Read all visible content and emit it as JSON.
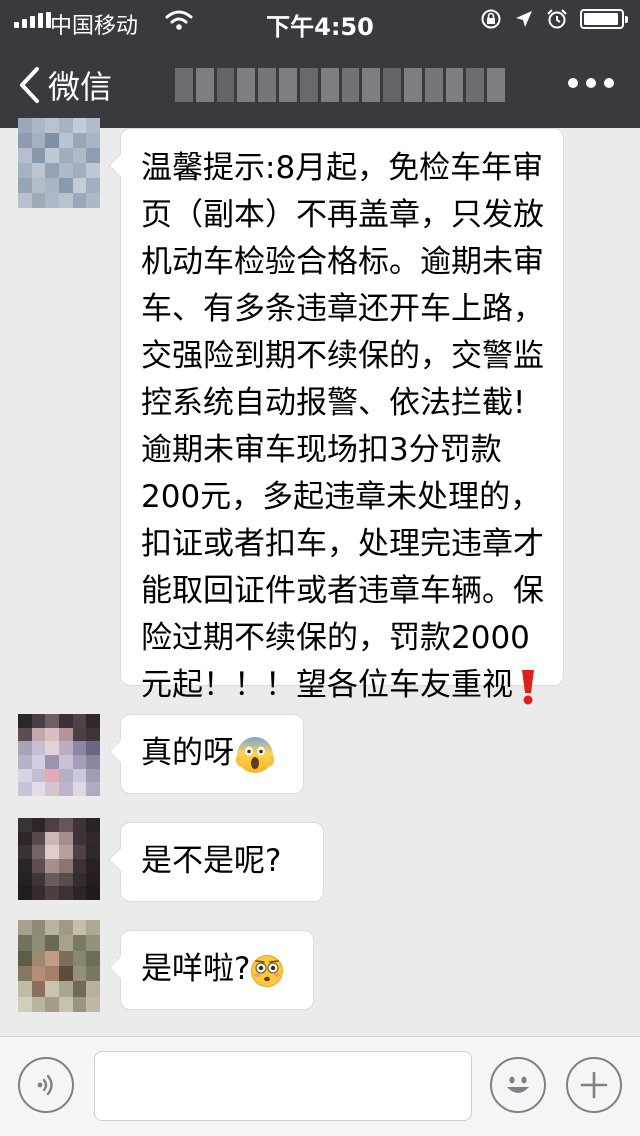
{
  "status_bar": {
    "carrier": "中国移动",
    "time": "下午4:50",
    "battery_level": 0.95
  },
  "nav": {
    "back_label": "微信",
    "more_icon": "more-dots-icon"
  },
  "messages": [
    {
      "sender": "other",
      "text": "温馨提示:8月起，免检车年审页（副本）不再盖章，只发放机动车检验合格标。逾期未审车、有多条违章还开车上路，交强险到期不续保的，交警监控系统自动报警、依法拦截! 逾期未审车现场扣3分罚款200元，多起违章未处理的，扣证或者扣车，处理完违章才能取回证件或者违章车辆。保险过期不续保的，罚款2000元起！！！望各位车友重视",
      "emoji": "red-exclamation-icon"
    },
    {
      "sender": "other",
      "text": "真的呀",
      "emoji": "screaming-face-icon"
    },
    {
      "sender": "other",
      "text": "是不是呢?",
      "emoji": ""
    },
    {
      "sender": "other",
      "text": "是咩啦?",
      "emoji": "flushed-face-icon"
    }
  ],
  "input_bar": {
    "voice_icon": "voice-icon",
    "emoji_icon": "smiley-icon",
    "add_icon": "plus-icon",
    "message_value": ""
  },
  "colors": {
    "header_bg": "#393a3f",
    "chat_bg": "#ebebeb",
    "bubble_bg": "#ffffff",
    "exclamation_red": "#e0211b"
  }
}
